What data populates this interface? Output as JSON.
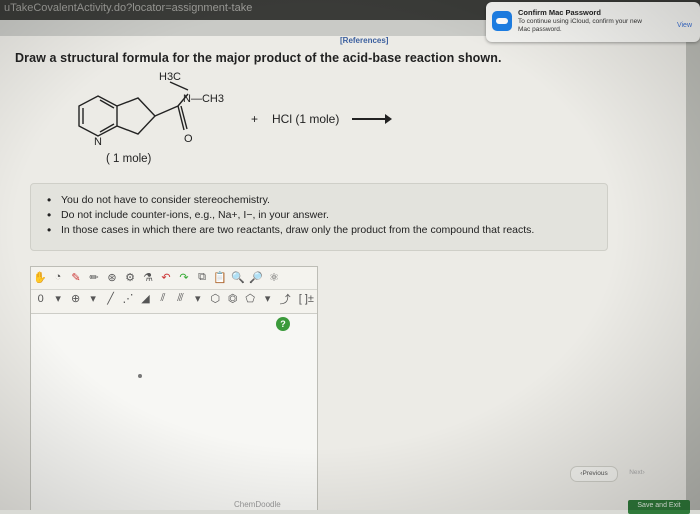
{
  "browser": {
    "url_text": "uTakeCovalentActivity.do?locator=assignment-take"
  },
  "references_label": "[References]",
  "question": "Draw a structural formula for the major product of the acid-base reaction shown.",
  "reaction": {
    "reactant_labels": {
      "h3c": "H3C",
      "n_methyl": "N—CH3",
      "n_ring": "N",
      "o": "O"
    },
    "plus": "+",
    "reagent": "HCl (1 mole)",
    "reactant_amount": "( 1 mole)"
  },
  "notes": [
    "You do not have to consider stereochemistry.",
    "Do not include counter-ions, e.g., Na+, I−, in your answer.",
    "In those cases in which there are two reactants, draw only the product from the compound that reacts."
  ],
  "editor": {
    "toolbar_row2_charge": "0",
    "bracket_tool": "[ ]±",
    "help": "?",
    "watermark": "ChemDoodle"
  },
  "notification": {
    "title": "Confirm Mac Password",
    "body": "To continue using iCloud, confirm your new Mac password.",
    "view": "View"
  },
  "nav": {
    "previous": "Previous",
    "next": "Next",
    "save": "Save and Exit"
  }
}
